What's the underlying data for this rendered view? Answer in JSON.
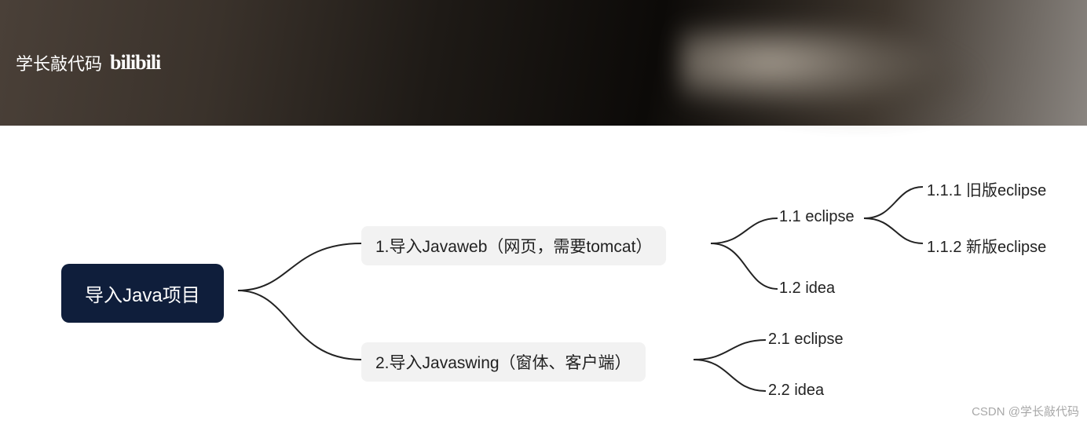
{
  "header": {
    "brand_text": "学长敲代码",
    "logo_text": "bilibili"
  },
  "mindmap": {
    "root": "导入Java项目",
    "branch1": {
      "label": "1.导入Javaweb（网页，需要tomcat）",
      "child1": {
        "label": "1.1 eclipse",
        "sub1": "1.1.1 旧版eclipse",
        "sub2": "1.1.2 新版eclipse"
      },
      "child2": "1.2 idea"
    },
    "branch2": {
      "label": "2.导入Javaswing（窗体、客户端）",
      "child1": "2.1 eclipse",
      "child2": "2.2 idea"
    }
  },
  "watermark": "CSDN @学长敲代码"
}
